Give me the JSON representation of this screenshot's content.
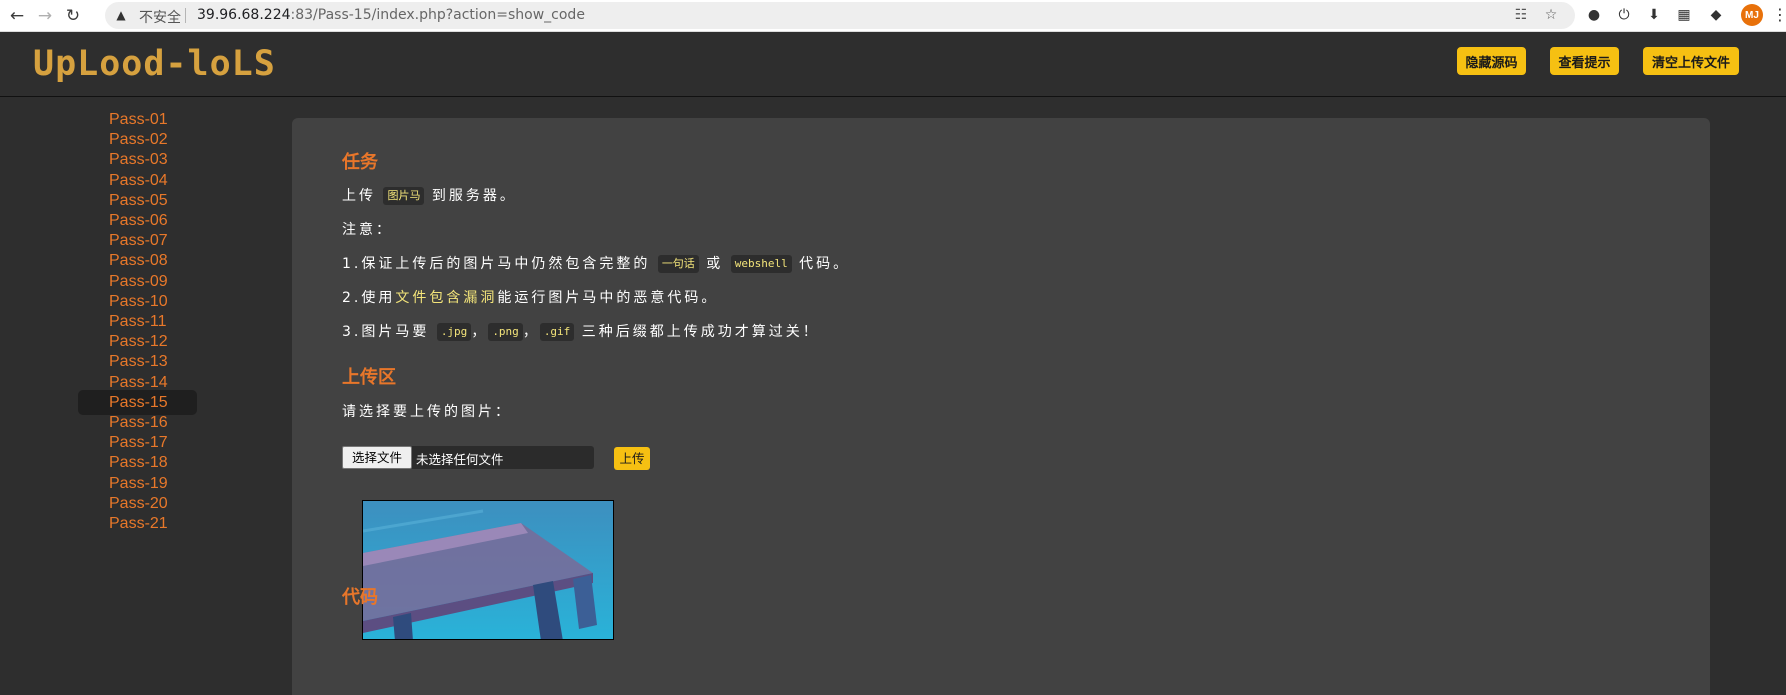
{
  "browser": {
    "security_label": "不安全",
    "url_host": "39.96.68.224",
    "url_port_path": ":83/Pass-15/index.php?action=show_code",
    "avatar_initials": "MJ"
  },
  "header": {
    "logo_text": "UpLood-loLS",
    "buttons": [
      "隐藏源码",
      "查看提示",
      "清空上传文件"
    ],
    "button_color": "#f6c012"
  },
  "sidebar": {
    "items": [
      "Pass-01",
      "Pass-02",
      "Pass-03",
      "Pass-04",
      "Pass-05",
      "Pass-06",
      "Pass-07",
      "Pass-08",
      "Pass-09",
      "Pass-10",
      "Pass-11",
      "Pass-12",
      "Pass-13",
      "Pass-14",
      "Pass-15",
      "Pass-16",
      "Pass-17",
      "Pass-18",
      "Pass-19",
      "Pass-20",
      "Pass-21"
    ],
    "active": "Pass-15",
    "link_color": "#e8782a"
  },
  "task": {
    "title": "任务",
    "line1": {
      "pre": "上传",
      "code": "图片马",
      "post": "到服务器。"
    },
    "note": "注意：",
    "item1": {
      "pre": "1.保证上传后的图片马中仍然包含完整的",
      "code1": "一句话",
      "mid": "或",
      "code2": "webshell",
      "post": "代码。"
    },
    "item2": {
      "pre": "2.使用",
      "link": "文件包含漏洞",
      "post": "能运行图片马中的恶意代码。"
    },
    "item3": {
      "pre": "3.图片马要",
      "ext1": ".jpg",
      "sep1": "，",
      "ext2": ".png",
      "sep2": "，",
      "ext3": ".gif",
      "post": "三种后缀都上传成功才算过关！"
    }
  },
  "upload": {
    "title": "上传区",
    "prompt": "请选择要上传的图片：",
    "choose_button": "选择文件",
    "no_file": "未选择任何文件",
    "submit_button": "上传"
  },
  "code_section": {
    "title": "代码"
  },
  "accent_color": "#e8762a"
}
